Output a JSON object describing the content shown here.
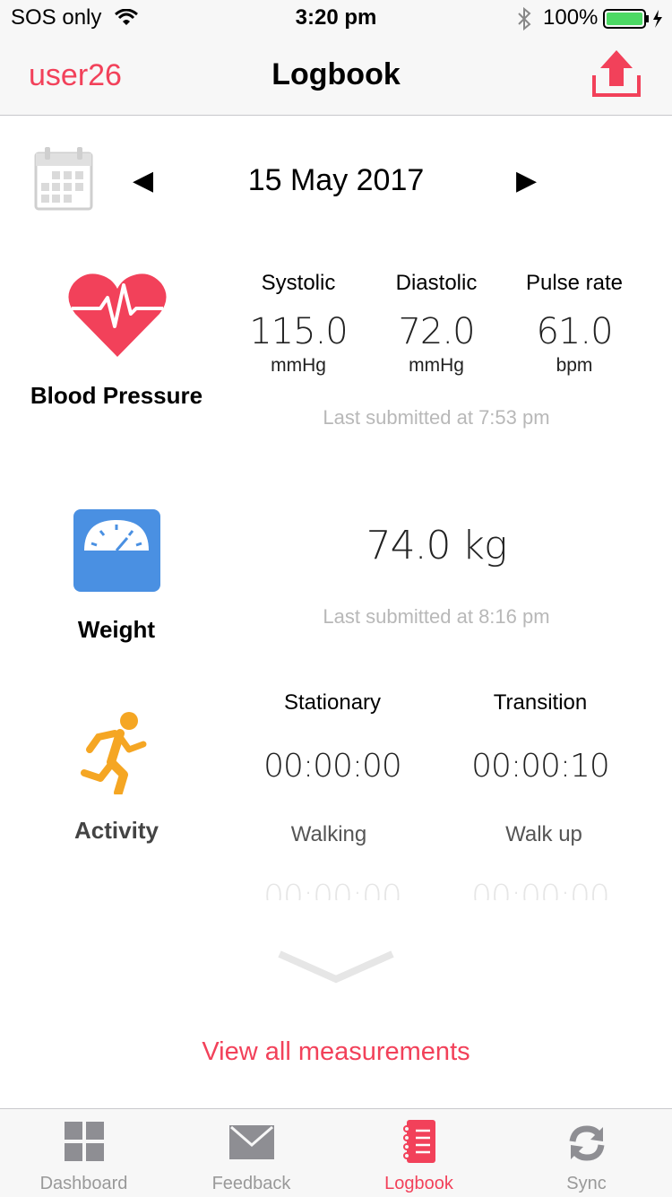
{
  "status_bar": {
    "carrier": "SOS only",
    "time": "3:20 pm",
    "battery": "100%"
  },
  "nav": {
    "user": "user26",
    "title": "Logbook",
    "upload_icon": "upload-icon"
  },
  "date_row": {
    "date": "15 May 2017",
    "prev": "◀",
    "next": "▶"
  },
  "blood_pressure": {
    "label": "Blood Pressure",
    "columns": [
      {
        "head": "Systolic",
        "value": "115.0",
        "unit": "mmHg"
      },
      {
        "head": "Diastolic",
        "value": "72.0",
        "unit": "mmHg"
      },
      {
        "head": "Pulse rate",
        "value": "61.0",
        "unit": "bpm"
      }
    ],
    "last_submitted": "Last submitted at 7:53 pm"
  },
  "weight": {
    "label": "Weight",
    "value": "74.0 kg",
    "last_submitted": "Last submitted at 8:16 pm"
  },
  "activity": {
    "label": "Activity",
    "items": [
      {
        "head": "Stationary",
        "value": "00:00:00"
      },
      {
        "head": "Transition",
        "value": "00:00:10"
      },
      {
        "head": "Walking",
        "value": "00:00:00"
      },
      {
        "head": "Walk up",
        "value": "00:00:00"
      }
    ]
  },
  "view_all": "View all measurements",
  "tabs": [
    {
      "label": "Dashboard"
    },
    {
      "label": "Feedback"
    },
    {
      "label": "Logbook"
    },
    {
      "label": "Sync"
    }
  ],
  "colors": {
    "accent": "#f2415a",
    "heart": "#f2415a",
    "scale": "#4a90e2",
    "runner": "#f5a623",
    "icon_gray": "#8e8e93"
  }
}
